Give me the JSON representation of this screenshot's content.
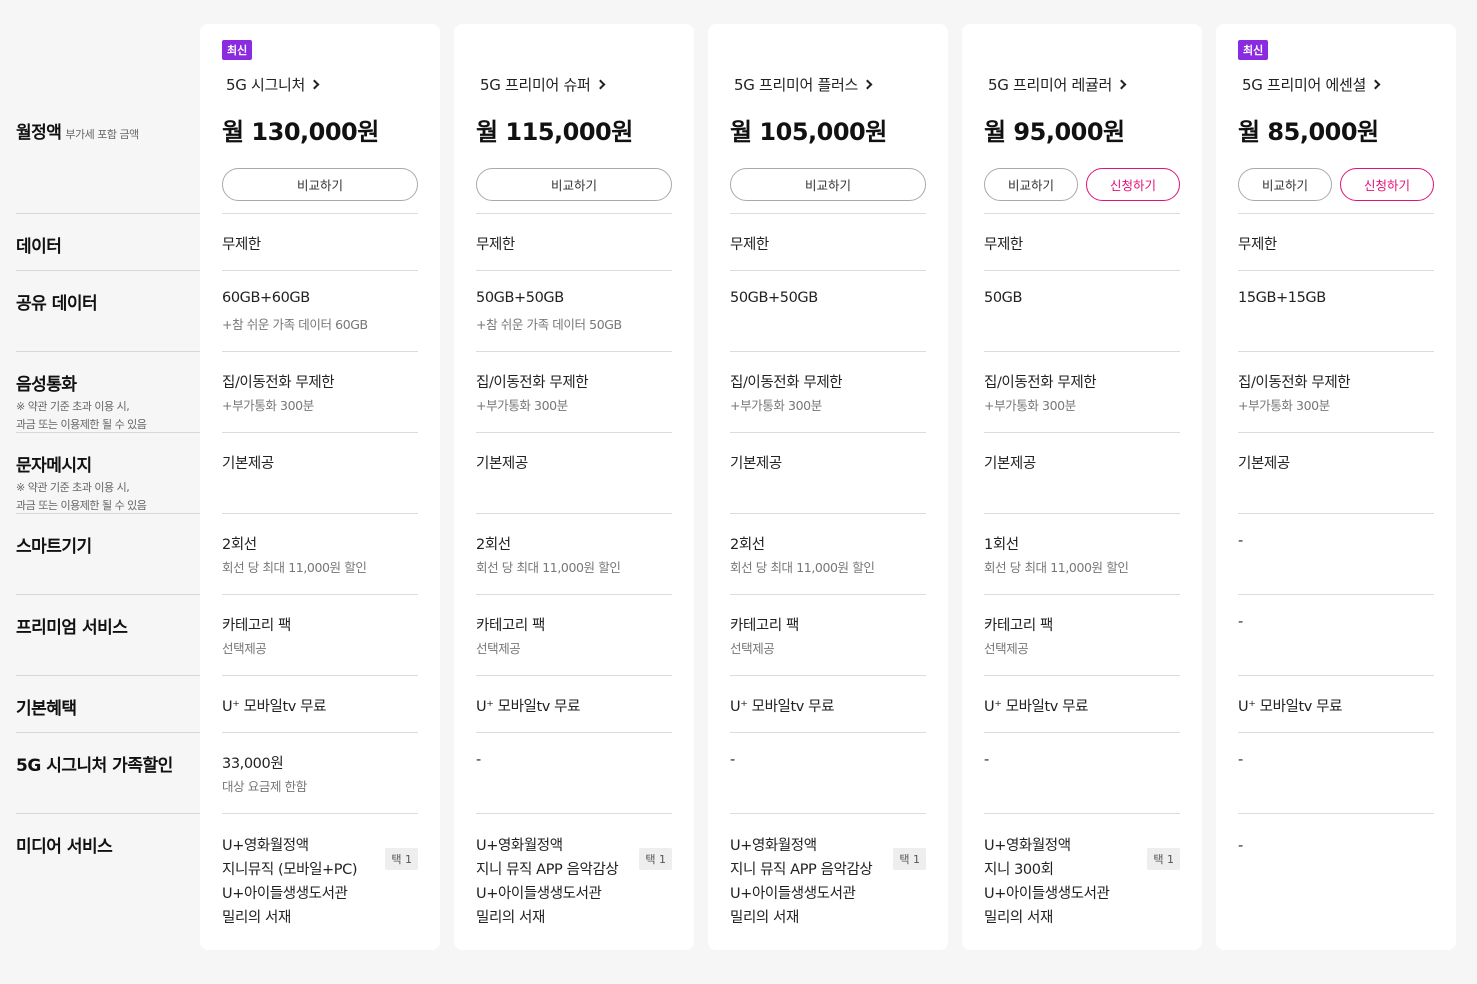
{
  "labels": {
    "monthly": "월정액",
    "monthly_sub": "부가세 포함 금액",
    "data": "데이터",
    "shared": "공유 데이터",
    "voice": "음성통화",
    "voice_note1": "※ 약관 기준 초과 이용 시,",
    "voice_note2": "과금 또는 이용제한 될 수 있음",
    "sms": "문자메시지",
    "sms_note1": "※ 약관 기준 초과 이용 시,",
    "sms_note2": "과금 또는 이용제한 될 수 있음",
    "smart": "스마트기기",
    "premium": "프리미엄 서비스",
    "basic": "기본혜택",
    "family": "5G 시그니처 가족할인",
    "media": "미디어 서비스"
  },
  "buttons": {
    "compare": "비교하기",
    "apply": "신청하기"
  },
  "plans": [
    {
      "badge": "최신",
      "name": "5G 시그니처",
      "price": "월 130,000원",
      "apply": false,
      "data": "무제한",
      "shared": "60GB+60GB",
      "shared_sub": "+참 쉬운 가족 데이터 60GB",
      "voice": "집/이동전화 무제한",
      "voice_sub": "+부가통화 300분",
      "sms": "기본제공",
      "smart": "2회선",
      "smart_sub": "회선 당 최대 11,000원 할인",
      "premium": "카테고리 팩",
      "premium_sub": "선택제공",
      "basic": "U⁺ 모바일tv 무료",
      "family": "33,000원",
      "family_sub": "대상 요금제 한함",
      "media": [
        "U+영화월정액",
        "지니뮤직 (모바일+PC)",
        "U+아이들생생도서관",
        "밀리의 서재"
      ],
      "pick": "택 1"
    },
    {
      "badge": "",
      "name": "5G 프리미어 슈퍼",
      "price": "월 115,000원",
      "apply": false,
      "data": "무제한",
      "shared": "50GB+50GB",
      "shared_sub": "+참 쉬운 가족 데이터 50GB",
      "voice": "집/이동전화 무제한",
      "voice_sub": "+부가통화 300분",
      "sms": "기본제공",
      "smart": "2회선",
      "smart_sub": "회선 당 최대 11,000원 할인",
      "premium": "카테고리 팩",
      "premium_sub": "선택제공",
      "basic": "U⁺ 모바일tv 무료",
      "family": "-",
      "family_sub": "",
      "media": [
        "U+영화월정액",
        "지니 뮤직 APP 음악감상",
        "U+아이들생생도서관",
        "밀리의 서재"
      ],
      "pick": "택 1"
    },
    {
      "badge": "",
      "name": "5G 프리미어 플러스",
      "price": "월 105,000원",
      "apply": false,
      "data": "무제한",
      "shared": "50GB+50GB",
      "shared_sub": "",
      "voice": "집/이동전화 무제한",
      "voice_sub": "+부가통화 300분",
      "sms": "기본제공",
      "smart": "2회선",
      "smart_sub": "회선 당 최대 11,000원 할인",
      "premium": "카테고리 팩",
      "premium_sub": "선택제공",
      "basic": "U⁺ 모바일tv 무료",
      "family": "-",
      "family_sub": "",
      "media": [
        "U+영화월정액",
        "지니 뮤직 APP 음악감상",
        "U+아이들생생도서관",
        "밀리의 서재"
      ],
      "pick": "택 1"
    },
    {
      "badge": "",
      "name": "5G 프리미어 레귤러",
      "price": "월 95,000원",
      "apply": true,
      "data": "무제한",
      "shared": "50GB",
      "shared_sub": "",
      "voice": "집/이동전화 무제한",
      "voice_sub": "+부가통화 300분",
      "sms": "기본제공",
      "smart": "1회선",
      "smart_sub": "회선 당 최대 11,000원 할인",
      "premium": "카테고리 팩",
      "premium_sub": "선택제공",
      "basic": "U⁺ 모바일tv 무료",
      "family": "-",
      "family_sub": "",
      "media": [
        "U+영화월정액",
        "지니 300회",
        "U+아이들생생도서관",
        "밀리의 서재"
      ],
      "pick": "택 1"
    },
    {
      "badge": "최신",
      "name": "5G 프리미어 에센셜",
      "price": "월 85,000원",
      "apply": true,
      "data": "무제한",
      "shared": "15GB+15GB",
      "shared_sub": "",
      "voice": "집/이동전화 무제한",
      "voice_sub": "+부가통화 300분",
      "sms": "기본제공",
      "smart": "-",
      "smart_sub": "",
      "premium": "-",
      "premium_sub": "",
      "basic": "U⁺ 모바일tv 무료",
      "family": "-",
      "family_sub": "",
      "media": [
        "-"
      ],
      "pick": ""
    }
  ]
}
